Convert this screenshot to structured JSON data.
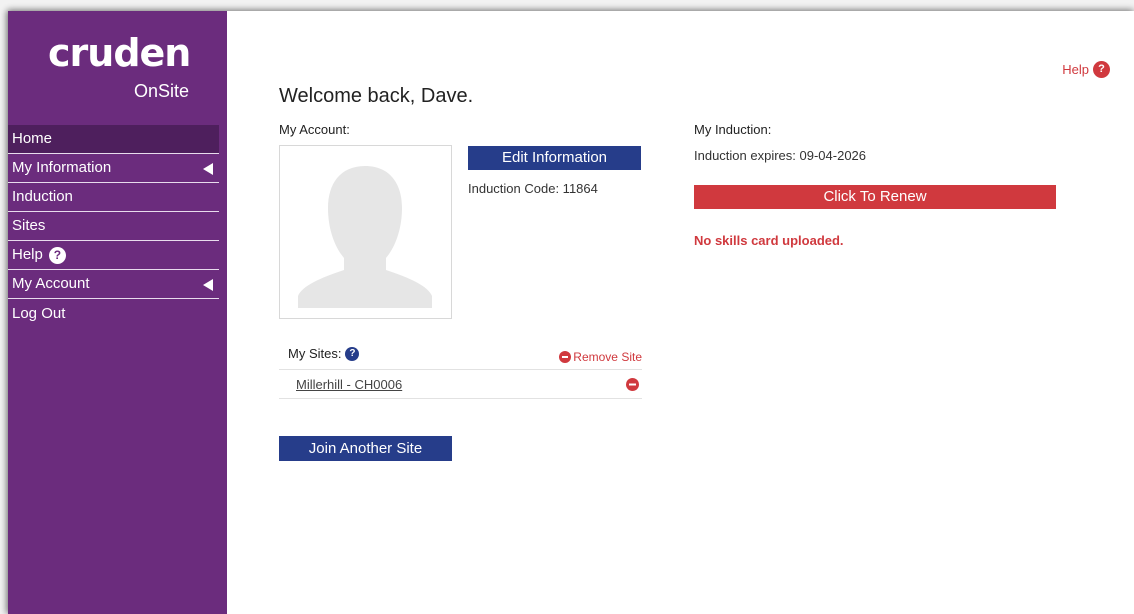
{
  "brand": {
    "name": "cruden",
    "product": "OnSite"
  },
  "nav": [
    {
      "label": "Home",
      "active": true,
      "has_arrow": false
    },
    {
      "label": "My Information",
      "has_arrow": true
    },
    {
      "label": "Induction",
      "has_arrow": false
    },
    {
      "label": "Sites",
      "has_arrow": false
    },
    {
      "label": "Help",
      "has_help_icon": true
    },
    {
      "label": "My Account",
      "has_arrow": true
    },
    {
      "label": "Log Out",
      "has_arrow": false
    }
  ],
  "help_link": {
    "label": "Help",
    "icon": "question-icon"
  },
  "welcome": "Welcome back, Dave.",
  "account": {
    "heading": "My Account:",
    "edit_button": "Edit Information",
    "induction_code": "Induction Code: 11864"
  },
  "induction": {
    "heading": "My Induction:",
    "expires": "Induction expires: 09-04-2026",
    "renew_button": "Click To Renew",
    "warning": "No skills card uploaded."
  },
  "sites": {
    "heading": "My Sites:",
    "remove_label": "Remove Site",
    "items": [
      {
        "name": "Millerhill - CH0006"
      }
    ],
    "join_button": "Join Another Site"
  },
  "colors": {
    "sidebar": "#6b2c7d",
    "sidebar_active": "#4e1f5d",
    "primary_blue": "#263d8a",
    "accent_red": "#d0393e"
  }
}
